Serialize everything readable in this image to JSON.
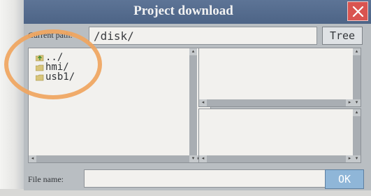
{
  "window": {
    "title": "Project download"
  },
  "path": {
    "label": "Current path:",
    "value": "/disk/"
  },
  "buttons": {
    "tree": "Tree",
    "ok": "OK"
  },
  "files": [
    {
      "name": "../",
      "icon": "up-folder-icon"
    },
    {
      "name": "hmi/",
      "icon": "folder-icon"
    },
    {
      "name": "usb1/",
      "icon": "folder-icon"
    }
  ],
  "filename": {
    "label": "File name:",
    "value": ""
  },
  "colors": {
    "titlebar": "#4d6486",
    "close": "#d95450",
    "ok_button": "#8fb6d8",
    "highlight": "#f0a55e"
  }
}
